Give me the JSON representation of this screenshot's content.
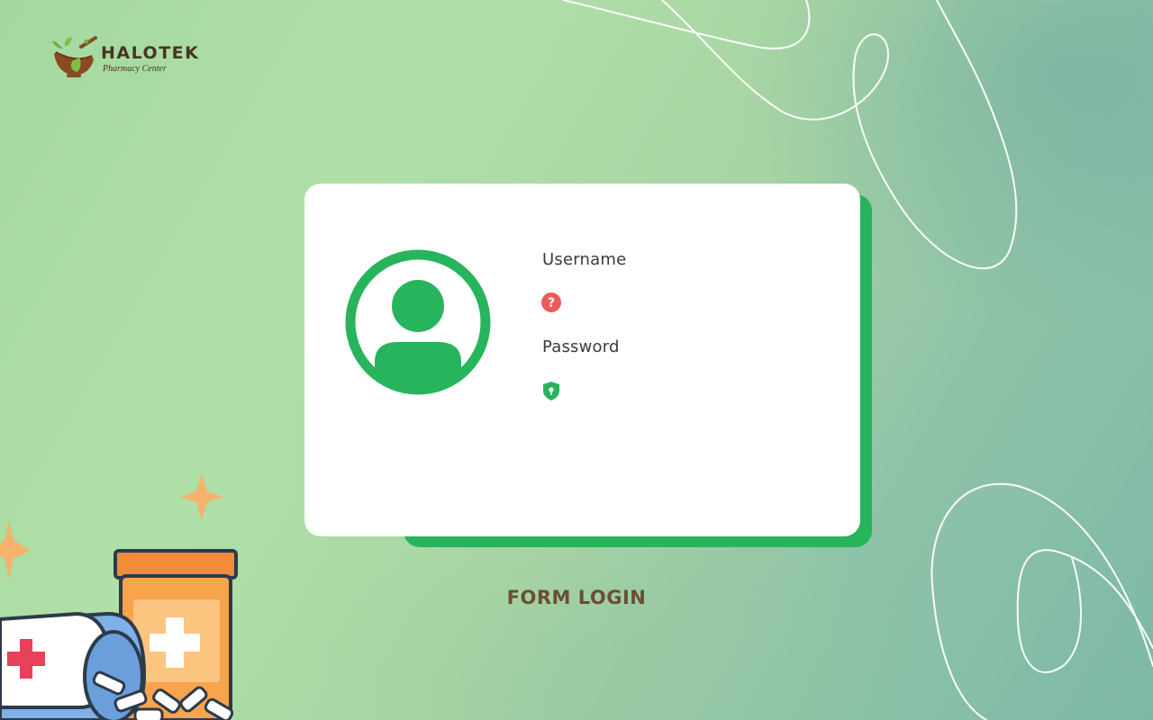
{
  "brand": {
    "name": "HALOTEK",
    "tagline": "Pharmacy Center"
  },
  "login_card": {
    "username_label": "Username",
    "username_value": "",
    "password_label": "Password",
    "password_value": ""
  },
  "page": {
    "title": "FORM LOGIN"
  },
  "icons": {
    "avatar": "user-avatar-icon",
    "username": "question-icon",
    "password": "shield-lock-icon"
  },
  "colors": {
    "accent_green": "#27b45c",
    "question_red": "#ee5a5a",
    "title_brown": "#6b4e35",
    "brand_brown": "#4a3424"
  }
}
